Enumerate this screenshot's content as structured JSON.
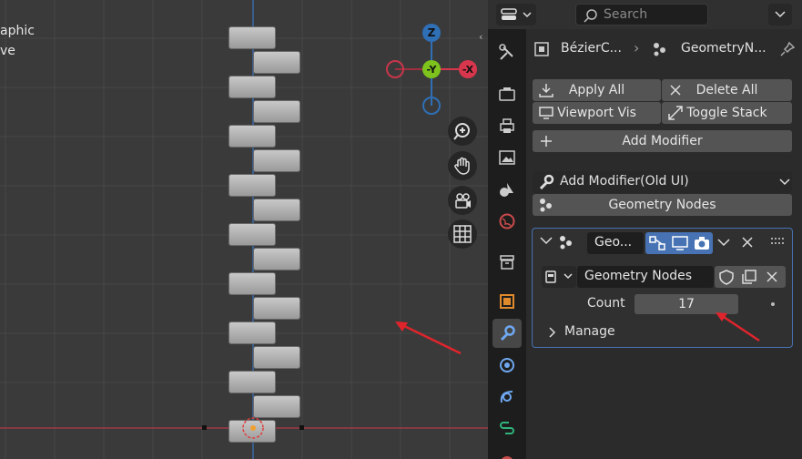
{
  "viewport": {
    "overlay_lines": [
      "aphic",
      "ve"
    ],
    "gizmo": {
      "z": "Z",
      "y": "-Y",
      "x": "-X"
    }
  },
  "header": {
    "search_placeholder": "Search"
  },
  "breadcrumb": {
    "object": "BézierC...",
    "modifier": "GeometryN..."
  },
  "actions": {
    "apply_all": "Apply All",
    "delete_all": "Delete All",
    "viewport_vis": "Viewport Vis",
    "toggle_stack": "Toggle Stack",
    "add_modifier": "Add Modifier"
  },
  "old_ui": {
    "label": "Add Modifier(Old UI)",
    "geometry_nodes": "Geometry Nodes"
  },
  "modifier": {
    "name": "Geo...",
    "node_group": "Geometry Nodes",
    "count_label": "Count",
    "count_value": "17",
    "manage_label": "Manage"
  },
  "colors": {
    "accent": "#4772b3",
    "annotation_arrow": "#e0242c",
    "gizmo_z": "#2f6fb5",
    "gizmo_y": "#7ec31d",
    "gizmo_x": "#d8364d"
  }
}
